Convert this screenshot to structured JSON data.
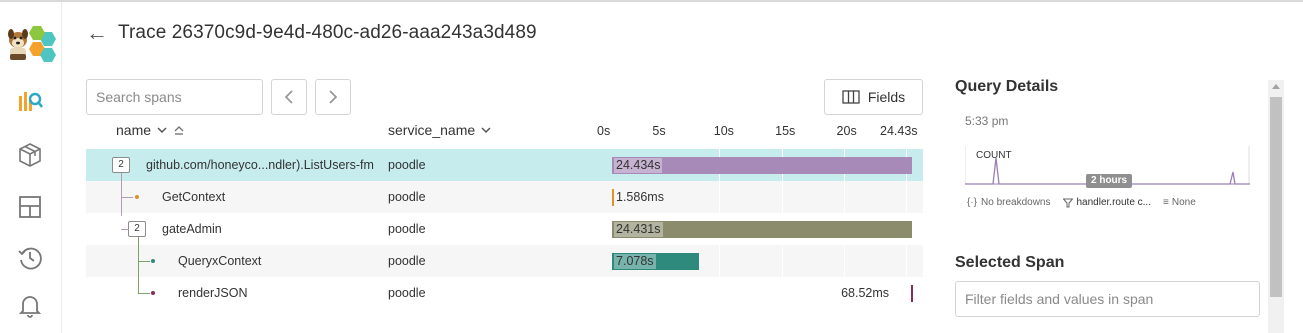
{
  "header": {
    "back_label": "←",
    "title": "Trace 26370c9d-9e4d-480c-ad26-aaa243a3d489"
  },
  "nav": {
    "icons": [
      "app-logo",
      "query-icon",
      "datasets-icon",
      "boards-icon",
      "history-icon",
      "alerts-icon"
    ],
    "accent": "#f4a22b"
  },
  "toolbar": {
    "search_placeholder": "Search spans",
    "prev_label": "‹",
    "next_label": "›",
    "fields_label": "Fields"
  },
  "columns": {
    "name": "name",
    "service": "service_name"
  },
  "timeline": {
    "ticks": [
      "0s",
      "5s",
      "10s",
      "15s",
      "20s",
      "24.43s"
    ],
    "total_seconds": 24.434
  },
  "spans": [
    {
      "name": "github.com/honeyco...ndler).ListUsers-fm",
      "service": "poodle",
      "children": "2",
      "duration_label": "24.434s",
      "start": 0,
      "duration": 24.434,
      "color": "#a88ab8",
      "selected": true
    },
    {
      "name": "GetContext",
      "service": "poodle",
      "duration_label": "1.586ms",
      "start": 0.001,
      "duration": 0.001586,
      "color": "#e0932a"
    },
    {
      "name": "gateAdmin",
      "service": "poodle",
      "children": "2",
      "duration_label": "24.431s",
      "start": 0.002,
      "duration": 24.431,
      "color": "#8a8c6c"
    },
    {
      "name": "QueryxContext",
      "service": "poodle",
      "duration_label": "7.078s",
      "start": 0.002,
      "duration": 7.078,
      "color": "#2f8a7e"
    },
    {
      "name": "renderJSON",
      "service": "poodle",
      "duration_label": "68.52ms",
      "start": 24.36,
      "duration": 0.06852,
      "color": "#8a2b5c"
    }
  ],
  "query_details": {
    "title": "Query Details",
    "time": "5:33 pm",
    "metric": "COUNT",
    "range_badge": "2 hours",
    "breakdowns": "No breakdowns",
    "filter": "handler.route c...",
    "order": "None"
  },
  "selected_span": {
    "title": "Selected Span",
    "filter_placeholder": "Filter fields and values in span"
  }
}
